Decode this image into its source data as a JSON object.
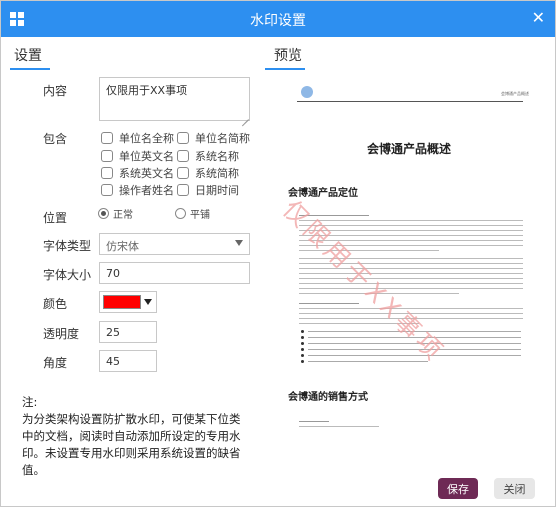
{
  "window": {
    "title": "水印设置"
  },
  "sections": {
    "settings": "设置",
    "preview": "预览"
  },
  "form": {
    "content_label": "内容",
    "content_value": "仅限用于XX事项",
    "include_label": "包含",
    "include_options": [
      {
        "label": "单位名全称",
        "checked": false
      },
      {
        "label": "单位名简称",
        "checked": false
      },
      {
        "label": "单位英文名",
        "checked": false
      },
      {
        "label": "系统名称",
        "checked": false
      },
      {
        "label": "系统英文名",
        "checked": false
      },
      {
        "label": "系统简称",
        "checked": false
      },
      {
        "label": "操作者姓名",
        "checked": false
      },
      {
        "label": "日期时间",
        "checked": false
      }
    ],
    "position_label": "位置",
    "position_options": [
      {
        "label": "正常",
        "selected": true
      },
      {
        "label": "平铺",
        "selected": false
      }
    ],
    "font_type_label": "字体类型",
    "font_type_value": "仿宋体",
    "font_size_label": "字体大小",
    "font_size_value": "70",
    "color_label": "颜色",
    "color_value": "#ff0000",
    "opacity_label": "透明度",
    "opacity_value": "25",
    "angle_label": "角度",
    "angle_value": "45"
  },
  "note": {
    "title": "注:",
    "body": "为分类架构设置防扩散水印，可使某下位类中的文档，阅读时自动添加所设定的专用水印。未设置专用水印则采用系统设置的缺省值。"
  },
  "preview_doc": {
    "header_text": "会博通产品概述",
    "title": "会博通产品概述",
    "h2_1": "会博通产品定位",
    "h2_2": "会博通的销售方式",
    "watermark": "仅限用于XX事项"
  },
  "buttons": {
    "save": "保存",
    "close": "关闭"
  }
}
